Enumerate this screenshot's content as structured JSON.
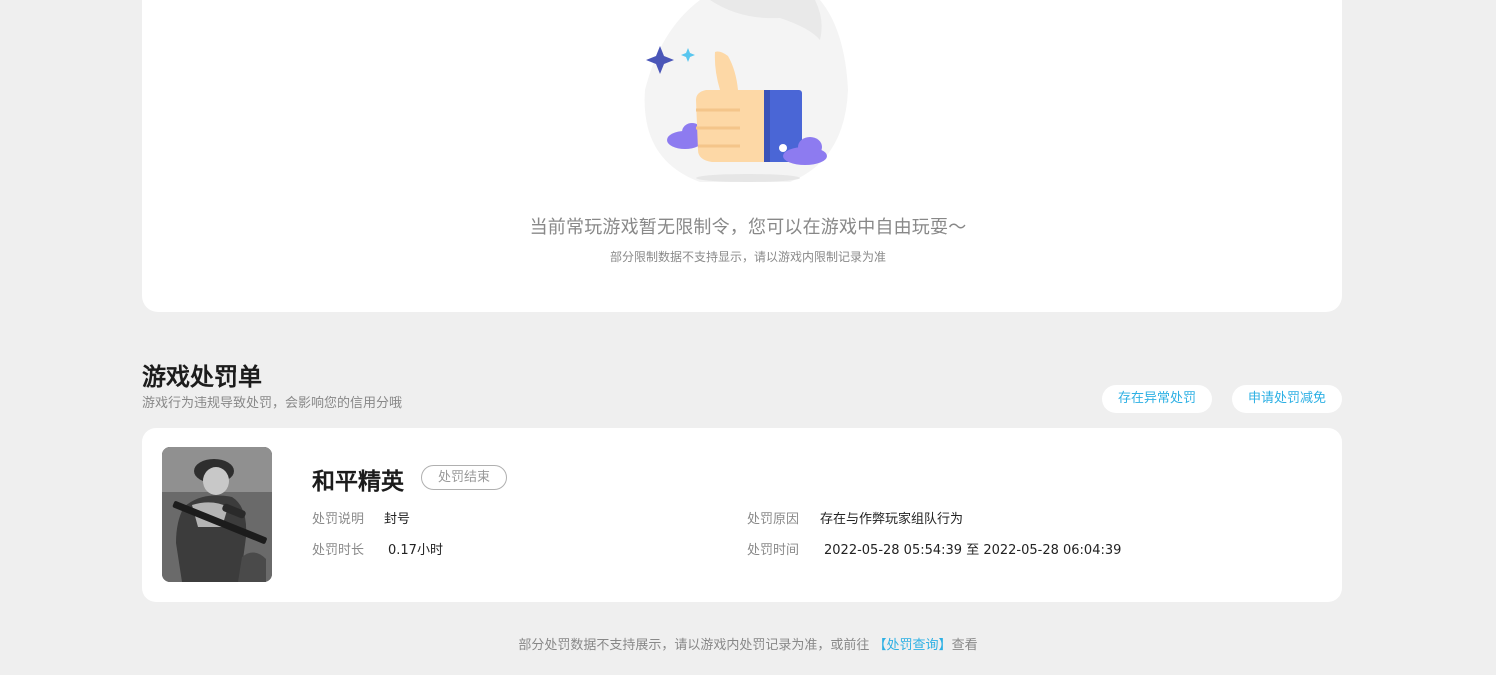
{
  "empty_state": {
    "title": "当前常玩游戏暂无限制令，您可以在游戏中自由玩耍～",
    "subtitle": "部分限制数据不支持显示，请以游戏内限制记录为准",
    "icon": "thumbs-up-icon"
  },
  "penalty_section": {
    "title": "游戏处罚单",
    "subtitle": "游戏行为违规导致处罚，会影响您的信用分哦",
    "buttons": {
      "abnormal": "存在异常处罚",
      "reduce": "申请处罚减免"
    }
  },
  "penalty_card": {
    "game_name": "和平精英",
    "status": "处罚结束",
    "fields": {
      "desc_label": "处罚说明",
      "desc_value": "封号",
      "duration_label": "处罚时长",
      "duration_value": "0.17小时",
      "reason_label": "处罚原因",
      "reason_value": "存在与作弊玩家组队行为",
      "time_label": "处罚时间",
      "time_value": "2022-05-28 05:54:39 至 2022-05-28 06:04:39"
    }
  },
  "footer": {
    "text_before": "部分处罚数据不支持展示，请以游戏内处罚记录为准，或前往 ",
    "link": "【处罚查询】",
    "text_after": "查看"
  },
  "colors": {
    "accent": "#2db0e4",
    "background": "#efefef",
    "card": "#ffffff"
  }
}
